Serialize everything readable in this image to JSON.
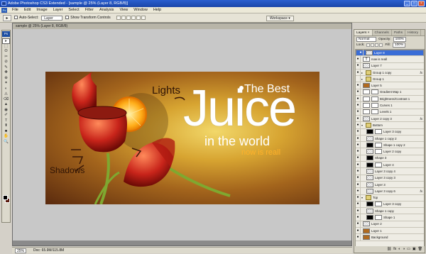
{
  "app": {
    "title": "Adobe Photoshop CS3 Extended - [sample @ 25% (Layer 8, RGB/8)]",
    "controls": [
      "_",
      "□",
      "×"
    ]
  },
  "menu": [
    "File",
    "Edit",
    "Image",
    "Layer",
    "Select",
    "Filter",
    "Analysis",
    "View",
    "Window",
    "Help"
  ],
  "options": {
    "auto_select_label": "Auto-Select:",
    "auto_select_value": "Layer",
    "show_transform_label": "Show Transform Controls",
    "workspace_label": "Workspace ▾"
  },
  "toolbox": {
    "badge": "Ps",
    "tools": [
      "▸",
      "⬚",
      "ʘ",
      "✂",
      "⊘",
      "✎",
      "✚",
      "⊕",
      "✦",
      "◐",
      "◬",
      "⌫",
      "▲",
      "◉",
      "✐",
      "T",
      "⬆",
      "■",
      "✋",
      "🔍"
    ]
  },
  "document": {
    "title": "sample @ 25% (Layer 8, RGB/8)"
  },
  "artwork": {
    "headline_top": "The Best",
    "headline_main": "Juice",
    "headline_sub": "in the world",
    "tagline": "now is reall",
    "note_lights": "Lights",
    "note_shadows": "Shadows"
  },
  "status": {
    "zoom": "25%",
    "doc_size": "Doc: 65.9M/115.8M"
  },
  "panel": {
    "tabs": [
      "Layers ×",
      "Channels",
      "Paths",
      "History"
    ],
    "blend_mode": "Normal",
    "opacity_label": "Opacity:",
    "opacity_value": "100%",
    "lock_label": "Lock:",
    "fill_label": "Fill:",
    "fill_value": "100%",
    "layers": [
      {
        "name": "Layer 8",
        "selected": true,
        "thumb": "checker"
      },
      {
        "name": "now is reall",
        "thumb": "text"
      },
      {
        "name": "Layer 7",
        "thumb": "checker"
      },
      {
        "name": "Group 1 copy",
        "thumb": "folder",
        "fx": true,
        "arrow": "▸"
      },
      {
        "name": "Group 1",
        "thumb": "folder",
        "arrow": "▸",
        "hidden": true
      },
      {
        "name": "Layer 5",
        "thumb": "orange"
      },
      {
        "name": "Gradient Map 1",
        "thumb": "adj",
        "mask": "white"
      },
      {
        "name": "Brightness/Contrast 1",
        "thumb": "adj",
        "mask": "white"
      },
      {
        "name": "Curves 1",
        "thumb": "adj",
        "mask": "white"
      },
      {
        "name": "Levels 1",
        "thumb": "adj",
        "mask": "white"
      },
      {
        "name": "Layer 2 copy 3",
        "thumb": "checker",
        "fx": true
      },
      {
        "name": "Bottom",
        "thumb": "folder",
        "arrow": "▾"
      },
      {
        "name": "Layer 3 copy",
        "thumb": "black",
        "mask": "white",
        "indent": true
      },
      {
        "name": "Shape 1 copy 2",
        "thumb": "checker",
        "indent": true
      },
      {
        "name": "Shape 1 copy 2",
        "thumb": "black",
        "mask": "white",
        "indent": true
      },
      {
        "name": "Layer 2 copy",
        "thumb": "checker",
        "mask": "white",
        "indent": true
      },
      {
        "name": "Shape 3",
        "thumb": "black",
        "indent": true
      },
      {
        "name": "Layer 4",
        "thumb": "black",
        "mask": "white",
        "indent": true
      },
      {
        "name": "Layer 3 copy 4",
        "thumb": "checker",
        "indent": true
      },
      {
        "name": "Layer 3 copy 3",
        "thumb": "checker",
        "indent": true
      },
      {
        "name": "Layer 3",
        "thumb": "checker",
        "indent": true
      },
      {
        "name": "Layer 3 copy 6",
        "thumb": "checker",
        "fx": true,
        "indent": true
      },
      {
        "name": "Top",
        "thumb": "folder",
        "arrow": "▾"
      },
      {
        "name": "Layer 3 copy",
        "thumb": "black",
        "mask": "white",
        "indent": true
      },
      {
        "name": "Shape 1 copy",
        "thumb": "checker",
        "indent": true
      },
      {
        "name": "Shape 1",
        "thumb": "black",
        "mask": "white",
        "indent": true
      },
      {
        "name": "Layer 2",
        "thumb": "checker"
      },
      {
        "name": "Layer 1",
        "thumb": "orange"
      },
      {
        "name": "Background",
        "thumb": "orange"
      }
    ],
    "bottom_icons": [
      "⛓",
      "fx",
      "◐",
      "◑",
      "▭",
      "▣",
      "🗑"
    ]
  }
}
